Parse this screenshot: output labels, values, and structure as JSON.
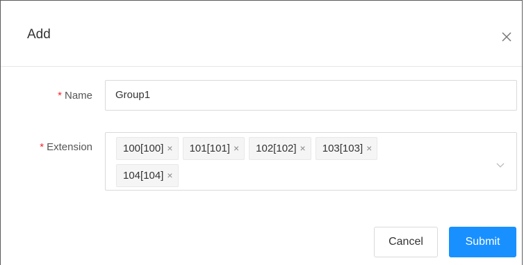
{
  "dialog": {
    "title": "Add",
    "close_icon": "close-icon"
  },
  "form": {
    "required_mark": "*",
    "name": {
      "label": "Name",
      "value": "Group1"
    },
    "extension": {
      "label": "Extension",
      "tags": [
        {
          "label": "100[100]",
          "remove": "×"
        },
        {
          "label": "101[101]",
          "remove": "×"
        },
        {
          "label": "102[102]",
          "remove": "×"
        },
        {
          "label": "103[103]",
          "remove": "×"
        },
        {
          "label": "104[104]",
          "remove": "×"
        }
      ],
      "dropdown_icon": "chevron-down-icon"
    }
  },
  "footer": {
    "cancel_label": "Cancel",
    "submit_label": "Submit"
  },
  "colors": {
    "primary": "#1890ff",
    "required": "#f5222d",
    "border": "#d9d9d9"
  }
}
